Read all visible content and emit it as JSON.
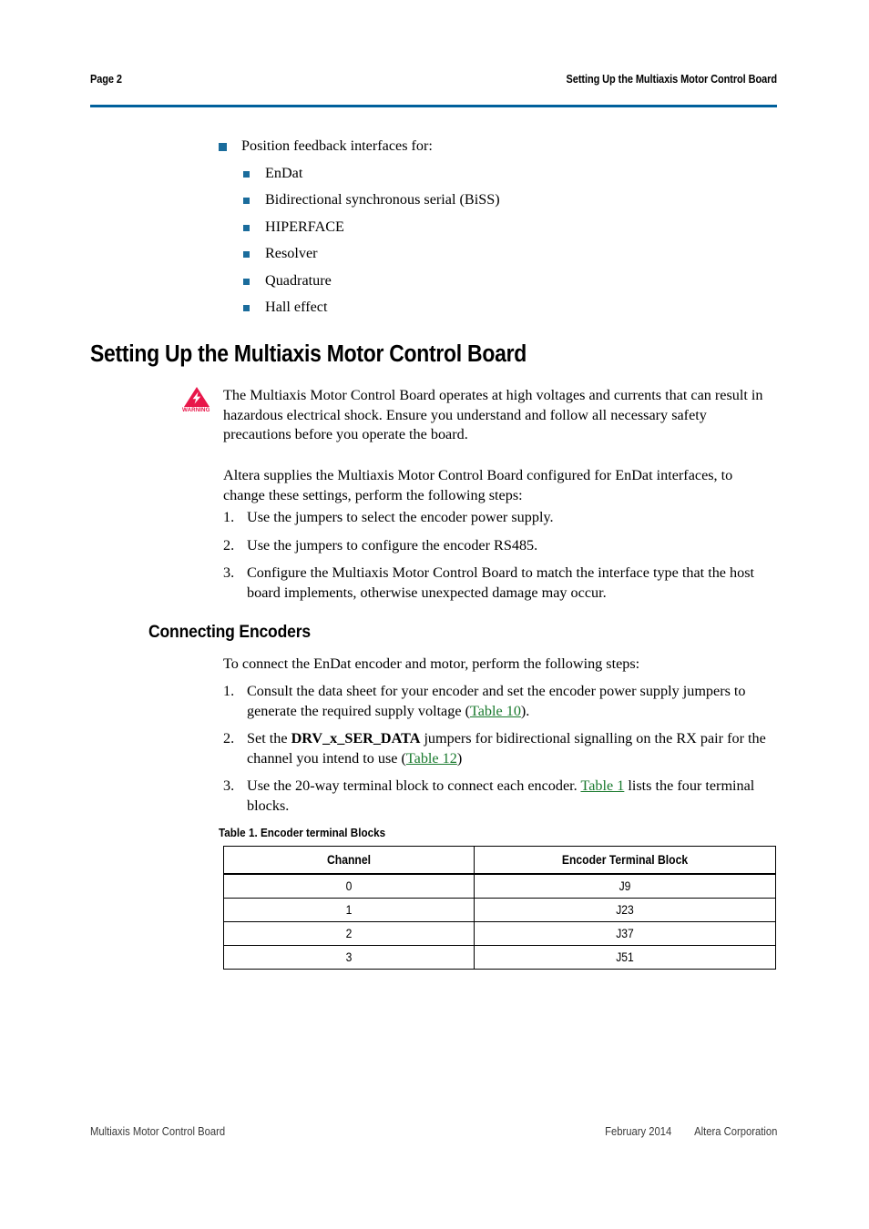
{
  "header": {
    "left": "Page 2",
    "right": "Setting Up the Multiaxis Motor Control Board",
    "rule_color": "#00609C"
  },
  "colors": {
    "bullet": "#1A6C9C",
    "rule": "#00609C",
    "link": "#1A7A2E",
    "warning": "#E8174A"
  },
  "bullets": {
    "lead": "Position feedback interfaces for:",
    "items": [
      "EnDat",
      "Bidirectional synchronous serial (BiSS)",
      "HIPERFACE",
      "Resolver",
      "Quadrature",
      "Hall effect"
    ]
  },
  "section": {
    "heading": "Setting Up the Multiaxis Motor Control Board",
    "warning": {
      "icon_label": "WARNING",
      "text": "The Multiaxis Motor Control Board operates at high voltages and currents that can result in hazardous electrical shock. Ensure you understand and follow all necessary safety precautions before you operate the board."
    },
    "intro": "Altera supplies the Multiaxis Motor Control Board configured for EnDat interfaces, to change these settings, perform the following steps:",
    "steps": [
      {
        "num": "1.",
        "text": "Use the jumpers to select the encoder power supply."
      },
      {
        "num": "2.",
        "text": "Use the jumpers to configure the encoder RS485."
      },
      {
        "num": "3.",
        "text": "Configure the Multiaxis Motor Control Board to match the interface type that the host board implements, otherwise unexpected damage may occur."
      }
    ]
  },
  "subsection": {
    "heading": "Connecting Encoders",
    "intro": "To connect the EnDat encoder and motor, perform the following steps:",
    "steps": [
      {
        "num": "1.",
        "pre": "Consult the data sheet for your encoder and set the encoder power supply jumpers to generate the required supply voltage (",
        "link": "Table 10",
        "post": ")."
      },
      {
        "num": "2.",
        "pre": "Set the ",
        "bold": "DRV_x_SER_DATA",
        "mid": " jumpers for bidirectional signalling on the RX pair for the channel you intend to use (",
        "link": "Table 12",
        "post": ")"
      },
      {
        "num": "3.",
        "pre": "Use the 20-way terminal block to connect each encoder. ",
        "link": "Table 1",
        "post": " lists the four terminal blocks."
      }
    ]
  },
  "table": {
    "caption": "Table 1.  Encoder terminal Blocks",
    "columns": [
      "Channel",
      "Encoder Terminal Block"
    ],
    "rows": [
      [
        "0",
        "J9"
      ],
      [
        "1",
        "J23"
      ],
      [
        "2",
        "J37"
      ],
      [
        "3",
        "J51"
      ]
    ]
  },
  "footer": {
    "left": "Multiaxis Motor Control Board",
    "date": "February 2014",
    "company": "Altera Corporation"
  }
}
